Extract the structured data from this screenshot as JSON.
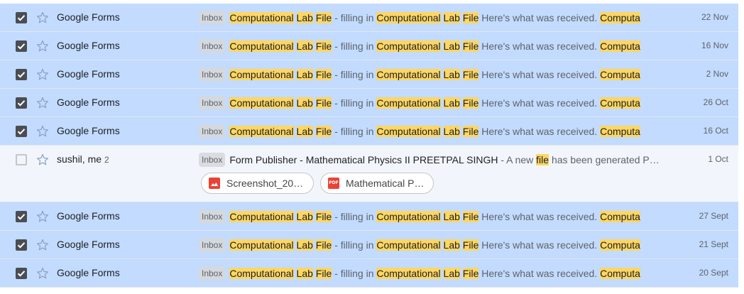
{
  "emails": [
    {
      "selected": true,
      "sender": "Google Forms",
      "count": "",
      "label": "Inbox",
      "subject_parts": [
        "Computational",
        " ",
        "Lab",
        " ",
        "File"
      ],
      "mid": " - filling in ",
      "mid_parts": [
        "Computational",
        " ",
        "Lab",
        " ",
        "File"
      ],
      "snippet": " Here's what was received. ",
      "tail": "Computa",
      "date": "22 Nov"
    },
    {
      "selected": true,
      "sender": "Google Forms",
      "count": "",
      "label": "Inbox",
      "date": "16 Nov"
    },
    {
      "selected": true,
      "sender": "Google Forms",
      "count": "",
      "label": "Inbox",
      "date": "2 Nov"
    },
    {
      "selected": true,
      "sender": "Google Forms",
      "count": "",
      "label": "Inbox",
      "date": "26 Oct"
    },
    {
      "selected": true,
      "sender": "Google Forms",
      "count": "",
      "label": "Inbox",
      "date": "16 Oct"
    },
    {
      "selected": false,
      "sender": "sushil, me",
      "count": "2",
      "label": "Inbox",
      "subject": "Form Publisher - Mathematical Physics II PREETPAL SINGH",
      "snippet_pre": " - A new ",
      "snippet_hl": "file",
      "snippet_post": " has been generated P…",
      "date": "1 Oct",
      "attachments": [
        {
          "name": "Screenshot_20…",
          "icon": "image-icon"
        },
        {
          "name": "Mathematical P…",
          "icon": "pdf-icon",
          "icon_text": "PDF"
        }
      ]
    },
    {
      "selected": true,
      "sender": "Google Forms",
      "count": "",
      "label": "Inbox",
      "date": "27 Sept"
    },
    {
      "selected": true,
      "sender": "Google Forms",
      "count": "",
      "label": "Inbox",
      "date": "21 Sept"
    },
    {
      "selected": true,
      "sender": "Google Forms",
      "count": "",
      "label": "Inbox",
      "date": "20 Sept"
    }
  ],
  "form_email": {
    "subject_w1": "Computational",
    "subject_w2": "Lab",
    "subject_w3": "File",
    "mid": " - filling in ",
    "snippet": " Here's what was received. ",
    "tail": "Computa"
  },
  "colors": {
    "selected_row": "#c2dbff",
    "unselected_row": "#f2f6fc",
    "highlight": "#fdd663"
  }
}
